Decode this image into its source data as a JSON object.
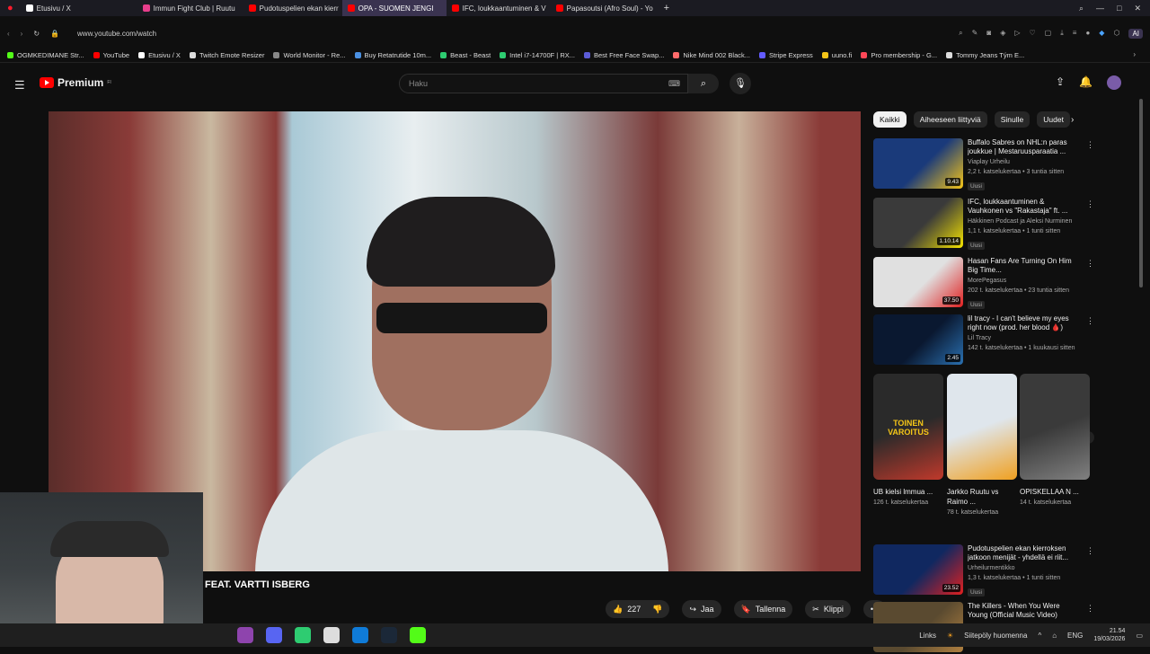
{
  "browser": {
    "tabs": [
      {
        "label": "Etusivu / X",
        "color": "#ffffff"
      },
      {
        "label": "Immun Fight Club | Ruutu",
        "color": "#e83e8c"
      },
      {
        "label": "Pudotuspelien ekan kierr",
        "color": "#ff0000"
      },
      {
        "label": "OPA - SUOMEN JENGI",
        "color": "#ff0000"
      },
      {
        "label": "IFC, loukkaantuminen & V",
        "color": "#ff0000"
      },
      {
        "label": "Papasoutsi (Afro Soul) - Yo",
        "color": "#ff0000"
      }
    ],
    "active_tab": 3,
    "new_tab": "+",
    "url": "www.youtube.com/watch",
    "ai_label": "AI",
    "bookmarks": [
      {
        "label": "OGMKEDIMANE Str...",
        "color": "#53fc18"
      },
      {
        "label": "YouTube",
        "color": "#ff0000"
      },
      {
        "label": "Etusivu / X",
        "color": "#ffffff"
      },
      {
        "label": "Twitch Emote Resizer",
        "color": "#dddddd"
      },
      {
        "label": "World Monitor - Re...",
        "color": "#888888"
      },
      {
        "label": "Buy Retatrutide 10m...",
        "color": "#4a90e2"
      },
      {
        "label": "Beast - Beast",
        "color": "#2ecc71"
      },
      {
        "label": "Intel i7-14700F | RX...",
        "color": "#2ecc71"
      },
      {
        "label": "Best Free Face Swap...",
        "color": "#5b5bd6"
      },
      {
        "label": "Nike Mind 002 Black...",
        "color": "#ff6b6b"
      },
      {
        "label": "Stripe Express",
        "color": "#635bff"
      },
      {
        "label": "uuno.fi",
        "color": "#f5c518"
      },
      {
        "label": "Pro membership - G...",
        "color": "#ff4757"
      },
      {
        "label": "Tommy Jeans Tým E...",
        "color": "#dddddd"
      }
    ]
  },
  "youtube": {
    "logo_text": "Premium",
    "logo_super": "FI",
    "search_placeholder": "Haku",
    "video_caption": "FEAT. VARTTI ISBERG",
    "actions": {
      "like_count": "227",
      "share": "Jaa",
      "save": "Tallenna",
      "clip": "Klippi",
      "more": "•••"
    },
    "chips": [
      "Kaikki",
      "Aiheeseen liittyviä",
      "Sinulle",
      "Uudet"
    ],
    "recommendations": [
      {
        "title": "Buffalo Sabres on NHL:n paras joukkue | Mestaruusparaatia ...",
        "channel": "Viaplay Urheilu",
        "meta": "2,2 t. katselukertaa • 3 tuntia sitten",
        "badge": "Uusi",
        "duration": "9.43",
        "colors": [
          "#1a3a7a",
          "#f5c518"
        ]
      },
      {
        "title": "IFC, loukkaantuminen & Vauhkonen vs \"Rakastaja\" ft. ...",
        "channel": "Häkkinen Podcast ja Aleksi Nurminen",
        "meta": "1,1 t. katselukertaa • 1 tunti sitten",
        "badge": "Uusi",
        "duration": "1.10.14",
        "colors": [
          "#3a3a3a",
          "#f5e400"
        ]
      },
      {
        "title": "Hasan Fans Are Turning On Him Big Time...",
        "channel": "MorePegasus",
        "meta": "202 t. katselukertaa • 23 tuntia sitten",
        "badge": "Uusi",
        "duration": "37.50",
        "colors": [
          "#e0e0e0",
          "#e02020"
        ]
      },
      {
        "title": "lil tracy - I can't believe my eyes right now (prod. her blood 🩸)",
        "channel": "Lil Tracy",
        "meta": "142 t. katselukertaa • 1 kuukausi sitten",
        "badge": "",
        "duration": "2.45",
        "colors": [
          "#0a1830",
          "#2a70b0"
        ]
      },
      {
        "title": "Pudotuspelien ekan kierroksen jatkoon menijät - yhdellä ei riit...",
        "channel": "Urheilurmentikko",
        "meta": "1,3 t. katselukertaa • 1 tunti sitten",
        "badge": "Uusi",
        "duration": "23.52",
        "colors": [
          "#102860",
          "#e02020"
        ]
      },
      {
        "title": "The Killers - When You Were Young (Official Music Video)",
        "channel": "",
        "meta": "",
        "badge": "",
        "duration": "",
        "colors": [
          "#5a4a30",
          "#b08040"
        ]
      }
    ],
    "shorts": [
      {
        "title": "UB kielsi lmmua ...",
        "meta": "126 t. katselukertaa",
        "overlay": "TOINEN VAROITUS",
        "colors": [
          "#2a2a2a",
          "#c0392b"
        ]
      },
      {
        "title": "Jarkko Ruutu vs Raimo ...",
        "meta": "78 t. katselukertaa",
        "overlay": "",
        "colors": [
          "#dfe6ec",
          "#f0a020"
        ]
      },
      {
        "title": "OPISKELLAA N ...",
        "meta": "14 t. katselukertaa",
        "overlay": "",
        "colors": [
          "#3a3a3a",
          "#808080"
        ]
      }
    ]
  },
  "taskbar": {
    "links_label": "Links",
    "weather": "Siitepöly huomenna",
    "lang": "ENG",
    "time": "21.54",
    "date": "19/03/2026",
    "icons": [
      {
        "name": "colorful-app",
        "color": "#8e44ad"
      },
      {
        "name": "discord",
        "color": "#5865f2"
      },
      {
        "name": "green-app",
        "color": "#2ecc71"
      },
      {
        "name": "shield-app",
        "color": "#dddddd"
      },
      {
        "name": "edge",
        "color": "#0f7bd8"
      },
      {
        "name": "steam",
        "color": "#1b2838"
      },
      {
        "name": "kick",
        "color": "#53fc18"
      }
    ]
  }
}
